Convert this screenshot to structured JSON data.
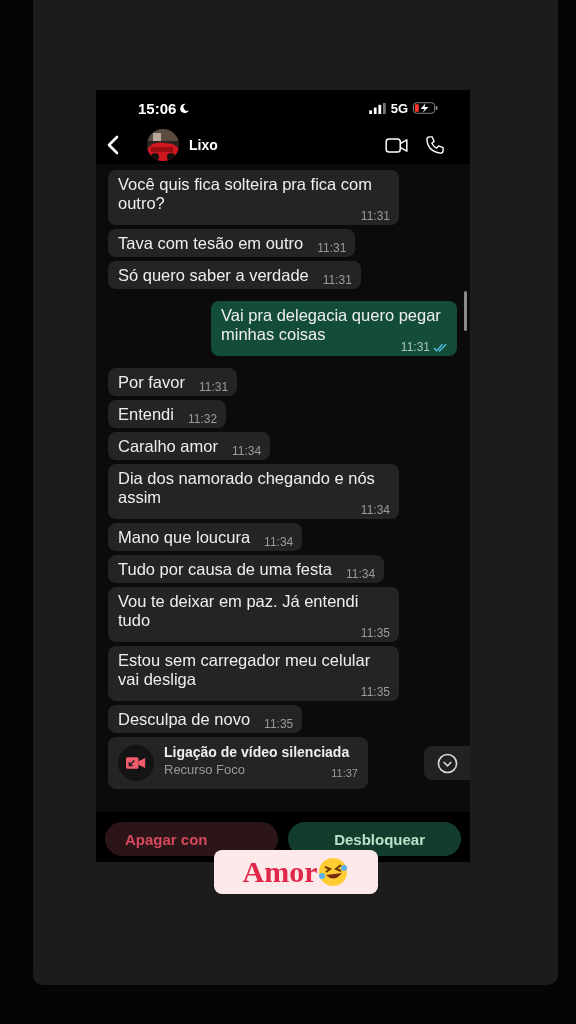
{
  "status_bar": {
    "time": "15:06",
    "network": "5G"
  },
  "header": {
    "contact_name": "Lixo"
  },
  "messages": [
    {
      "kind": "incoming",
      "text": "Você quis fica solteira pra fica com outro?",
      "time": "11:31"
    },
    {
      "kind": "incoming",
      "text": "Tava com tesão em outro",
      "time": "11:31"
    },
    {
      "kind": "incoming",
      "text": "Só quero saber a verdade",
      "time": "11:31"
    },
    {
      "kind": "outgoing",
      "text": "Vai pra delegacia quero pegar minhas coisas",
      "time": "11:31",
      "read": true
    },
    {
      "kind": "incoming",
      "text": "Por favor",
      "time": "11:31"
    },
    {
      "kind": "incoming",
      "text": "Entendi",
      "time": "11:32"
    },
    {
      "kind": "incoming",
      "text": "Caralho amor",
      "time": "11:34"
    },
    {
      "kind": "incoming",
      "text": "Dia dos namorado chegando e nós assim",
      "time": "11:34"
    },
    {
      "kind": "incoming",
      "text": "Mano que loucura",
      "time": "11:34"
    },
    {
      "kind": "incoming",
      "text": "Tudo por causa de uma festa",
      "time": "11:34"
    },
    {
      "kind": "incoming",
      "text": "Vou te deixar em paz. Já entendi tudo",
      "time": "11:35"
    },
    {
      "kind": "incoming",
      "text": "Estou sem carregador meu celular vai desliga",
      "time": "11:35"
    },
    {
      "kind": "incoming",
      "text": "Desculpa de novo",
      "time": "11:35"
    },
    {
      "kind": "call",
      "title": "Ligação de vídeo silenciada",
      "subtitle": "Recurso Foco",
      "time": "11:37"
    }
  ],
  "actions": [
    {
      "kind": "danger",
      "label": "Apagar con"
    },
    {
      "kind": "primary",
      "label": "Desbloquear"
    }
  ],
  "sticker": {
    "text": "Amor"
  }
}
